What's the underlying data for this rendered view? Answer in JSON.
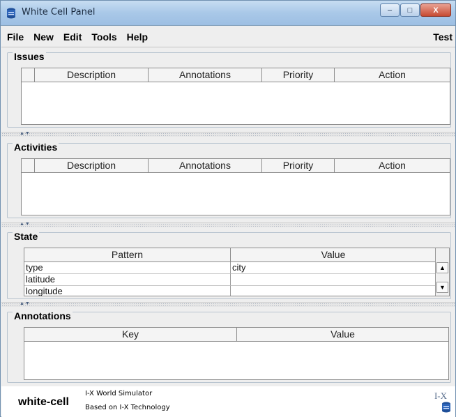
{
  "window": {
    "title": "White Cell Panel",
    "minimize": "–",
    "maximize": "□",
    "close": "X"
  },
  "menubar": {
    "items": [
      "File",
      "New",
      "Edit",
      "Tools",
      "Help"
    ],
    "right_label": "Test"
  },
  "issues": {
    "title": "Issues",
    "columns": [
      "",
      "Description",
      "Annotations",
      "Priority",
      "Action"
    ]
  },
  "activities": {
    "title": "Activities",
    "columns": [
      "",
      "Description",
      "Annotations",
      "Priority",
      "Action"
    ]
  },
  "state": {
    "title": "State",
    "columns": [
      "Pattern",
      "Value"
    ],
    "rows": [
      {
        "pattern": "type",
        "value": "city"
      },
      {
        "pattern": "latitude",
        "value": ""
      },
      {
        "pattern": "longitude",
        "value": ""
      }
    ]
  },
  "annotations": {
    "title": "Annotations",
    "columns": [
      "Key",
      "Value"
    ]
  },
  "footer": {
    "brand": "white-cell",
    "line1": "I-X World Simulator",
    "line2": "Based on I-X Technology",
    "logo": "I-X"
  },
  "colors": {
    "titlebar": "#a9c8e8",
    "close_button": "#c74a32",
    "panel_bg": "#eeeeee"
  }
}
